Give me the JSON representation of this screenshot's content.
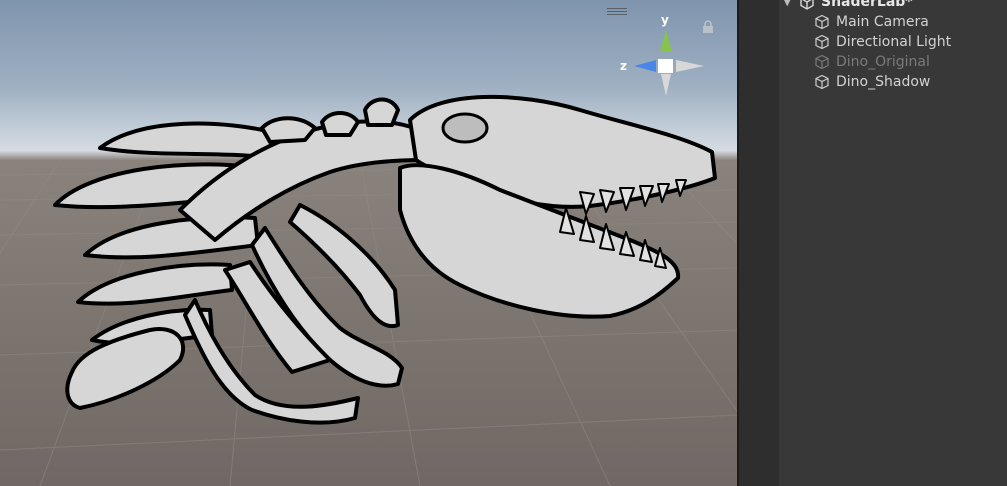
{
  "scene_view": {
    "gizmo": {
      "y_label": "y",
      "z_label": "z"
    },
    "subject": "skeleton-mesh"
  },
  "hierarchy": {
    "scene_name": "ShaderLab*",
    "items": [
      {
        "label": "Main Camera",
        "enabled": true,
        "icon": "cube-icon"
      },
      {
        "label": "Directional Light",
        "enabled": true,
        "icon": "cube-icon"
      },
      {
        "label": "Dino_Original",
        "enabled": false,
        "icon": "cube-icon"
      },
      {
        "label": "Dino_Shadow",
        "enabled": true,
        "icon": "cube-icon"
      }
    ]
  },
  "colors": {
    "panel_bg": "#383838",
    "gutter_bg": "#2e2e2e",
    "text": "#d2d2d2",
    "text_disabled": "#7b7b7b",
    "gizmo_y": "#86c34a",
    "gizmo_z": "#4a86e8",
    "bone": "#d9d9d9",
    "outline": "#000000"
  }
}
